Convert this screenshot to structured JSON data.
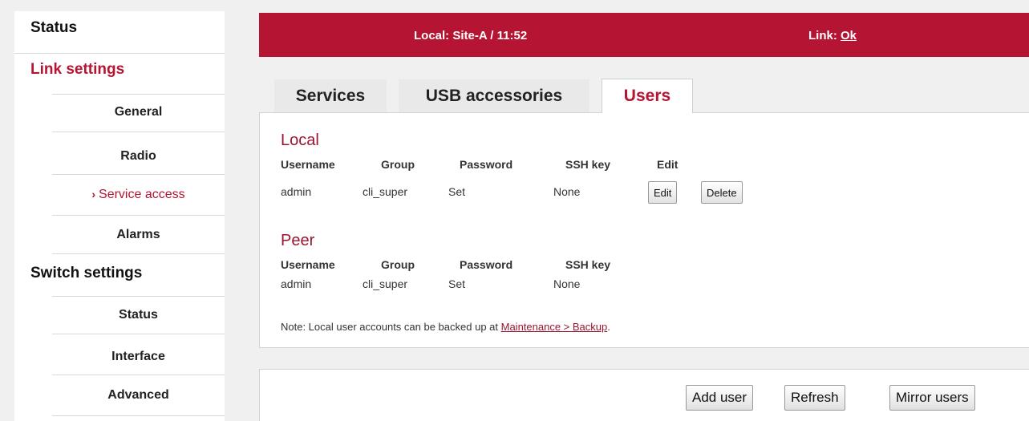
{
  "sidebar": {
    "status": "Status",
    "link_settings": "Link settings",
    "link_items": [
      "General",
      "Radio",
      "Service access",
      "Alarms"
    ],
    "current_item": "Service access",
    "switch_settings": "Switch settings",
    "switch_items": [
      "Status",
      "Interface",
      "Advanced"
    ]
  },
  "header": {
    "local_label": "Local: Site-A / 11:52",
    "link_prefix": "Link:",
    "link_status": "Ok"
  },
  "tabs": [
    "Services",
    "USB accessories",
    "Users"
  ],
  "active_tab": "Users",
  "local": {
    "title": "Local",
    "columns": [
      "Username",
      "Group",
      "Password",
      "SSH key",
      "Edit"
    ],
    "rows": [
      {
        "username": "admin",
        "group": "cli_super",
        "password": "Set",
        "ssh_key": "None",
        "edit_label": "Edit",
        "delete_label": "Delete"
      }
    ]
  },
  "peer": {
    "title": "Peer",
    "columns": [
      "Username",
      "Group",
      "Password",
      "SSH key"
    ],
    "rows": [
      {
        "username": "admin",
        "group": "cli_super",
        "password": "Set",
        "ssh_key": "None"
      }
    ]
  },
  "note": {
    "text": "Note: Local user accounts can be backed up at ",
    "link_text": "Maintenance > Backup",
    "suffix": "."
  },
  "footer": {
    "add_user": "Add user",
    "refresh": "Refresh",
    "mirror_users": "Mirror users"
  },
  "colors": {
    "brand_red": "#b51432",
    "dark_red": "#9b1530"
  }
}
